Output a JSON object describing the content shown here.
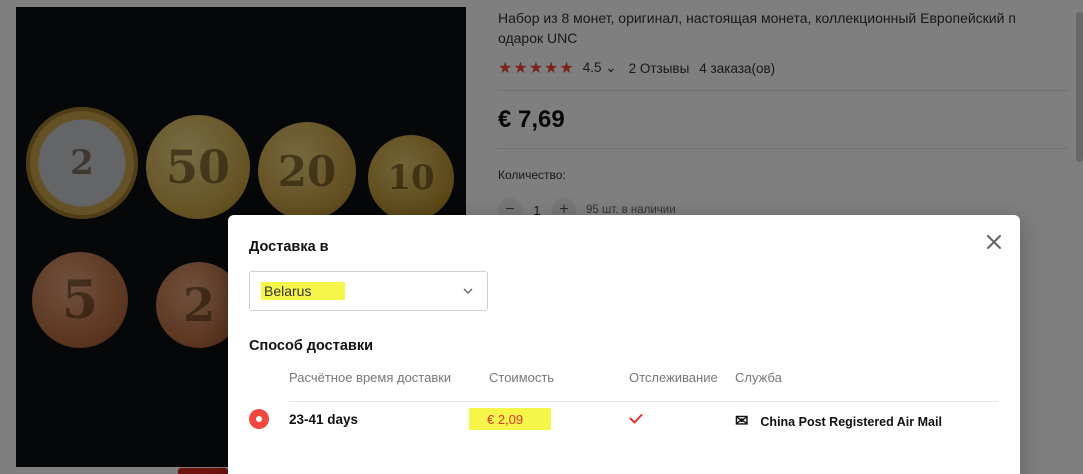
{
  "product": {
    "title": "Набор из 8 монет, оригинал, настоящая монета, коллекционный Европейский подарок UNC",
    "title_line1": "Набор из 8 монет, оригинал, настоящая монета, коллекционный Европейский п",
    "title_line2": "одарок UNC",
    "stars": "★★★★★",
    "rating": "4.5",
    "reviews": "2 Отзывы",
    "orders": "4 заказа(ов)",
    "price": "€ 7,69",
    "quantity_label": "Количество:",
    "quantity_value": "1",
    "minus_label": "−",
    "plus_label": "+",
    "stock": "95 шт. в наличии"
  },
  "coins": [
    "2",
    "50",
    "20",
    "10",
    "5",
    "2"
  ],
  "modal": {
    "title": "Доставка в",
    "country": "Belarus",
    "method_title": "Способ доставки",
    "columns": [
      "Расчётное время доставки",
      "Стоимость",
      "Отслеживание",
      "Служба"
    ],
    "rows": [
      {
        "days": "23-41 days",
        "cost": "€ 2,09",
        "tracking": true,
        "service": "China Post Registered Air Mail",
        "selected": true
      }
    ]
  },
  "colors": {
    "accent": "#f0483e",
    "highlight": "#f5f54a",
    "star": "#f04b3d"
  },
  "icons": {
    "close": "close-icon",
    "select": "chevron-down-icon",
    "radio": "radio-selected-icon",
    "tracking": "checkmark-icon",
    "service": "china-post-icon"
  }
}
